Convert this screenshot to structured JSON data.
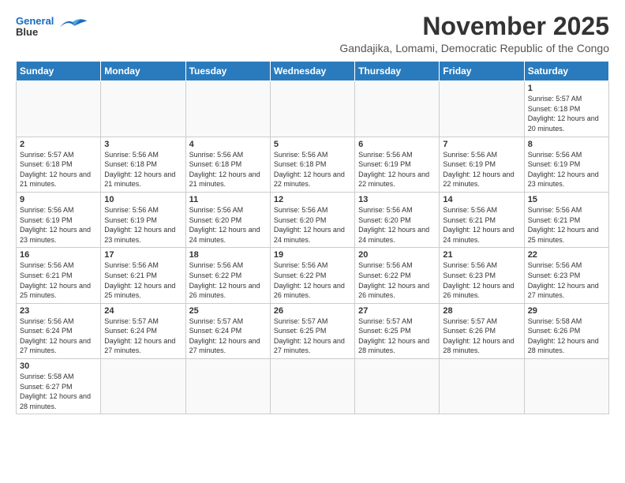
{
  "header": {
    "logo_line1": "General",
    "logo_line2": "Blue",
    "month_title": "November 2025",
    "subtitle": "Gandajika, Lomami, Democratic Republic of the Congo"
  },
  "days_of_week": [
    "Sunday",
    "Monday",
    "Tuesday",
    "Wednesday",
    "Thursday",
    "Friday",
    "Saturday"
  ],
  "weeks": [
    [
      {
        "day": "",
        "info": ""
      },
      {
        "day": "",
        "info": ""
      },
      {
        "day": "",
        "info": ""
      },
      {
        "day": "",
        "info": ""
      },
      {
        "day": "",
        "info": ""
      },
      {
        "day": "",
        "info": ""
      },
      {
        "day": "1",
        "info": "Sunrise: 5:57 AM\nSunset: 6:18 PM\nDaylight: 12 hours and 20 minutes."
      }
    ],
    [
      {
        "day": "2",
        "info": "Sunrise: 5:57 AM\nSunset: 6:18 PM\nDaylight: 12 hours and 21 minutes."
      },
      {
        "day": "3",
        "info": "Sunrise: 5:56 AM\nSunset: 6:18 PM\nDaylight: 12 hours and 21 minutes."
      },
      {
        "day": "4",
        "info": "Sunrise: 5:56 AM\nSunset: 6:18 PM\nDaylight: 12 hours and 21 minutes."
      },
      {
        "day": "5",
        "info": "Sunrise: 5:56 AM\nSunset: 6:18 PM\nDaylight: 12 hours and 22 minutes."
      },
      {
        "day": "6",
        "info": "Sunrise: 5:56 AM\nSunset: 6:19 PM\nDaylight: 12 hours and 22 minutes."
      },
      {
        "day": "7",
        "info": "Sunrise: 5:56 AM\nSunset: 6:19 PM\nDaylight: 12 hours and 22 minutes."
      },
      {
        "day": "8",
        "info": "Sunrise: 5:56 AM\nSunset: 6:19 PM\nDaylight: 12 hours and 23 minutes."
      }
    ],
    [
      {
        "day": "9",
        "info": "Sunrise: 5:56 AM\nSunset: 6:19 PM\nDaylight: 12 hours and 23 minutes."
      },
      {
        "day": "10",
        "info": "Sunrise: 5:56 AM\nSunset: 6:19 PM\nDaylight: 12 hours and 23 minutes."
      },
      {
        "day": "11",
        "info": "Sunrise: 5:56 AM\nSunset: 6:20 PM\nDaylight: 12 hours and 24 minutes."
      },
      {
        "day": "12",
        "info": "Sunrise: 5:56 AM\nSunset: 6:20 PM\nDaylight: 12 hours and 24 minutes."
      },
      {
        "day": "13",
        "info": "Sunrise: 5:56 AM\nSunset: 6:20 PM\nDaylight: 12 hours and 24 minutes."
      },
      {
        "day": "14",
        "info": "Sunrise: 5:56 AM\nSunset: 6:21 PM\nDaylight: 12 hours and 24 minutes."
      },
      {
        "day": "15",
        "info": "Sunrise: 5:56 AM\nSunset: 6:21 PM\nDaylight: 12 hours and 25 minutes."
      }
    ],
    [
      {
        "day": "16",
        "info": "Sunrise: 5:56 AM\nSunset: 6:21 PM\nDaylight: 12 hours and 25 minutes."
      },
      {
        "day": "17",
        "info": "Sunrise: 5:56 AM\nSunset: 6:21 PM\nDaylight: 12 hours and 25 minutes."
      },
      {
        "day": "18",
        "info": "Sunrise: 5:56 AM\nSunset: 6:22 PM\nDaylight: 12 hours and 26 minutes."
      },
      {
        "day": "19",
        "info": "Sunrise: 5:56 AM\nSunset: 6:22 PM\nDaylight: 12 hours and 26 minutes."
      },
      {
        "day": "20",
        "info": "Sunrise: 5:56 AM\nSunset: 6:22 PM\nDaylight: 12 hours and 26 minutes."
      },
      {
        "day": "21",
        "info": "Sunrise: 5:56 AM\nSunset: 6:23 PM\nDaylight: 12 hours and 26 minutes."
      },
      {
        "day": "22",
        "info": "Sunrise: 5:56 AM\nSunset: 6:23 PM\nDaylight: 12 hours and 27 minutes."
      }
    ],
    [
      {
        "day": "23",
        "info": "Sunrise: 5:56 AM\nSunset: 6:24 PM\nDaylight: 12 hours and 27 minutes."
      },
      {
        "day": "24",
        "info": "Sunrise: 5:57 AM\nSunset: 6:24 PM\nDaylight: 12 hours and 27 minutes."
      },
      {
        "day": "25",
        "info": "Sunrise: 5:57 AM\nSunset: 6:24 PM\nDaylight: 12 hours and 27 minutes."
      },
      {
        "day": "26",
        "info": "Sunrise: 5:57 AM\nSunset: 6:25 PM\nDaylight: 12 hours and 27 minutes."
      },
      {
        "day": "27",
        "info": "Sunrise: 5:57 AM\nSunset: 6:25 PM\nDaylight: 12 hours and 28 minutes."
      },
      {
        "day": "28",
        "info": "Sunrise: 5:57 AM\nSunset: 6:26 PM\nDaylight: 12 hours and 28 minutes."
      },
      {
        "day": "29",
        "info": "Sunrise: 5:58 AM\nSunset: 6:26 PM\nDaylight: 12 hours and 28 minutes."
      }
    ],
    [
      {
        "day": "30",
        "info": "Sunrise: 5:58 AM\nSunset: 6:27 PM\nDaylight: 12 hours and 28 minutes."
      },
      {
        "day": "",
        "info": ""
      },
      {
        "day": "",
        "info": ""
      },
      {
        "day": "",
        "info": ""
      },
      {
        "day": "",
        "info": ""
      },
      {
        "day": "",
        "info": ""
      },
      {
        "day": "",
        "info": ""
      }
    ]
  ]
}
